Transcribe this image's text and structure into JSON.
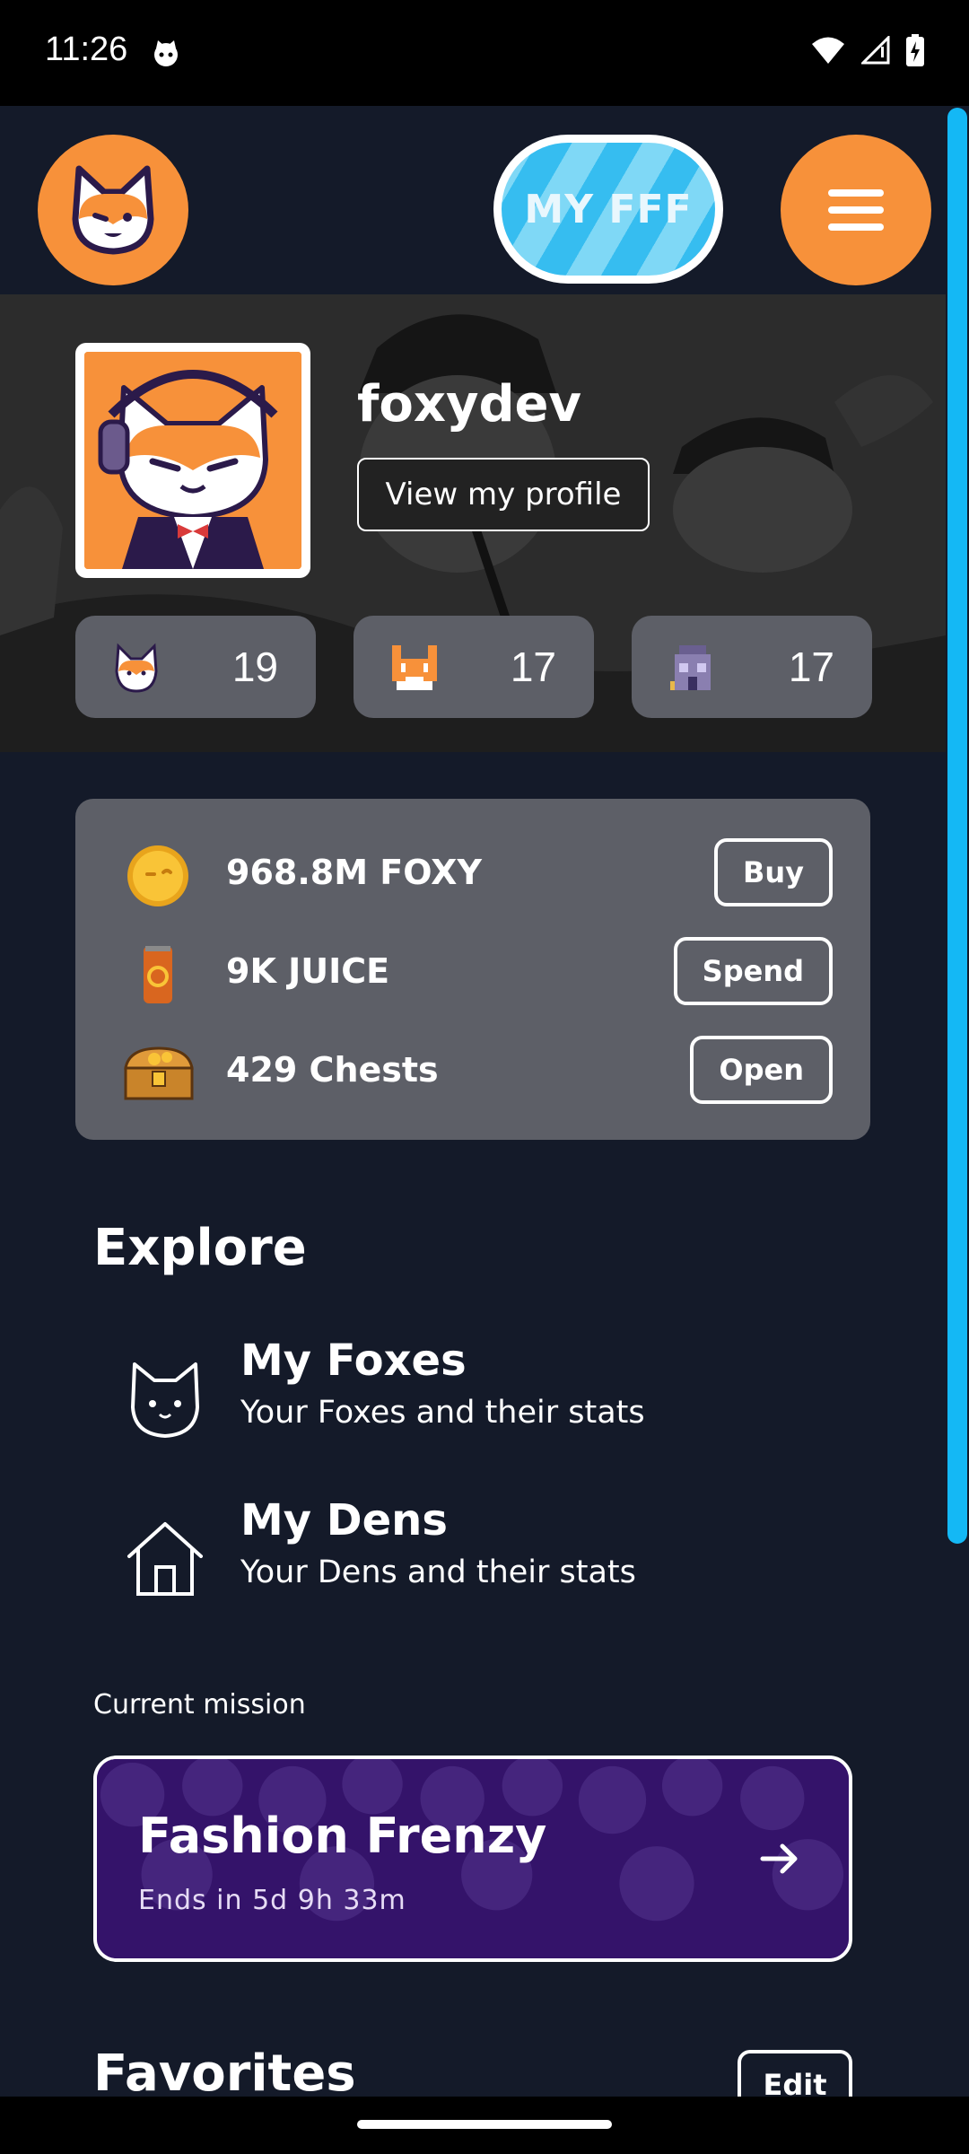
{
  "status_bar": {
    "time": "11:26",
    "icons": [
      "cat-notification-icon",
      "wifi-icon",
      "signal-icon",
      "battery-charging-icon"
    ]
  },
  "header": {
    "logo_icon": "fox-logo-icon",
    "fff_label": "MY FFF",
    "menu_icon": "hamburger-menu-icon"
  },
  "profile": {
    "username": "foxydev",
    "view_profile_label": "View my profile",
    "stats": [
      {
        "icon": "fox-face-icon",
        "count": "19"
      },
      {
        "icon": "pixel-fox-icon",
        "count": "17"
      },
      {
        "icon": "den-building-icon",
        "count": "17"
      }
    ]
  },
  "wallet": [
    {
      "icon": "foxy-coin-icon",
      "label": "968.8M FOXY",
      "action": "Buy"
    },
    {
      "icon": "juice-can-icon",
      "label": "9K JUICE",
      "action": "Spend"
    },
    {
      "icon": "treasure-chest-icon",
      "label": "429 Chests",
      "action": "Open"
    }
  ],
  "explore": {
    "title": "Explore",
    "items": [
      {
        "icon": "cat-outline-icon",
        "title": "My Foxes",
        "subtitle": "Your Foxes and their stats"
      },
      {
        "icon": "house-outline-icon",
        "title": "My Dens",
        "subtitle": "Your Dens and their stats"
      }
    ]
  },
  "mission": {
    "label": "Current mission",
    "title": "Fashion Frenzy",
    "ends": "Ends in 5d 9h 33m"
  },
  "favorites": {
    "title": "Favorites",
    "edit_label": "Edit"
  },
  "colors": {
    "background": "#141a29",
    "accent_orange": "#f7913a",
    "accent_blue": "#36bdf0",
    "card": "#5d5f67",
    "mission_purple": "#3d1a75"
  }
}
